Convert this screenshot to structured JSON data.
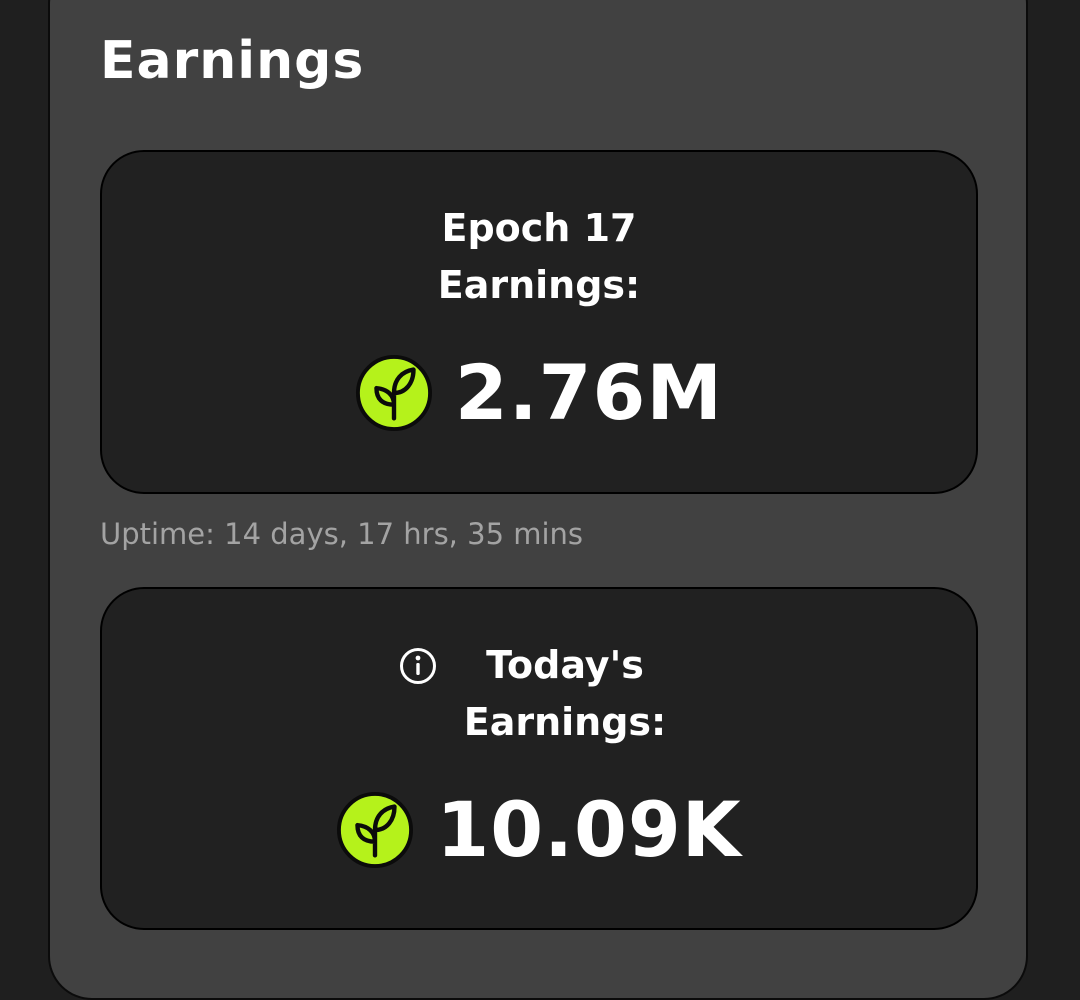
{
  "section": {
    "title": "Earnings"
  },
  "epoch_card": {
    "label_line1": "Epoch 17",
    "label_line2": "Earnings:",
    "amount": "2.76M",
    "coin_icon": "leaf-coin-icon"
  },
  "uptime": {
    "text": "Uptime: 14 days, 17 hrs, 35 mins"
  },
  "today_card": {
    "label_line1": "Today's",
    "label_line2": "Earnings:",
    "amount": "10.09K",
    "coin_icon": "leaf-coin-icon",
    "info_icon": "info-icon"
  },
  "colors": {
    "page_background": "#1f1f1f",
    "panel_background": "#414141",
    "card_background": "#212121",
    "coin_green": "#b5f21b",
    "text_primary": "#ffffff",
    "text_muted": "#a3a3a3"
  }
}
